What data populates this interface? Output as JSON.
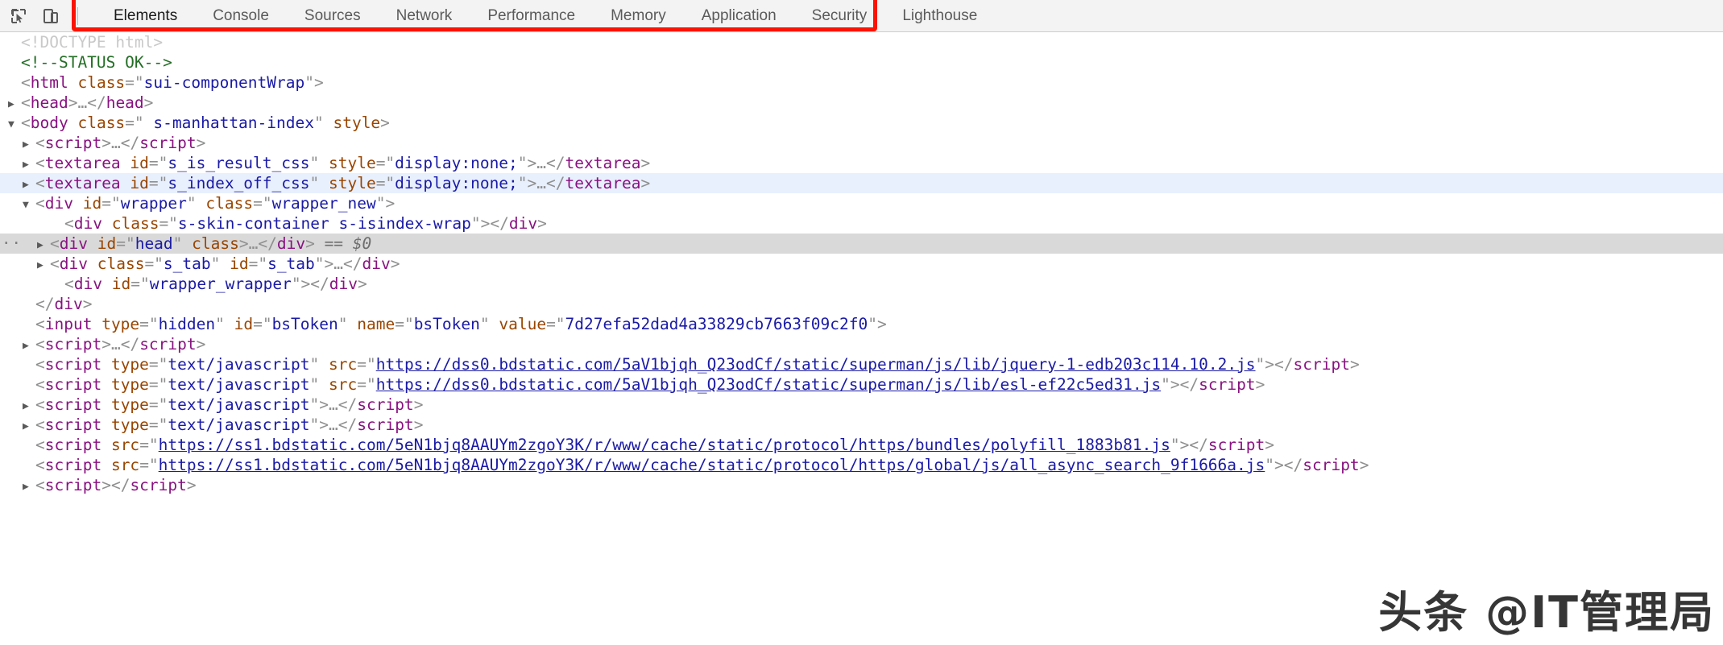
{
  "toolbar": {
    "icons": [
      {
        "name": "inspect-element-icon",
        "label": "Inspect element"
      },
      {
        "name": "device-toolbar-icon",
        "label": "Toggle device toolbar"
      }
    ],
    "tabs": [
      {
        "label": "Elements",
        "active": true
      },
      {
        "label": "Console",
        "active": false
      },
      {
        "label": "Sources",
        "active": false
      },
      {
        "label": "Network",
        "active": false
      },
      {
        "label": "Performance",
        "active": false
      },
      {
        "label": "Memory",
        "active": false
      },
      {
        "label": "Application",
        "active": false
      },
      {
        "label": "Security",
        "active": false
      },
      {
        "label": "Lighthouse",
        "active": false
      }
    ]
  },
  "annotation": {
    "color": "#fb1302",
    "target": "panel-tab-bar"
  },
  "colors": {
    "tag": "#881280",
    "attribute_name": "#994500",
    "attribute_value": "#1a1aa6",
    "comment": "#236e25",
    "punctuation": "#8f8f8f",
    "selected_row": "#d9d9d9",
    "hover_row": "#e8f0fd",
    "annotation_red": "#fb1302",
    "toolbar_bg": "#f3f3f3"
  },
  "dom": {
    "doctype_faded": "<!DOCTYPE html>",
    "comment_status": "<!--STATUS OK-->",
    "rows": {
      "html_open": {
        "tag": "html",
        "attr": "class",
        "value": "sui-componentWrap"
      },
      "head": {
        "tag": "head"
      },
      "body_open": {
        "tag": "body",
        "attr": "class",
        "value": " s-manhattan-index",
        "attr2": "style"
      },
      "script_1": {
        "tag": "script"
      },
      "textarea_1": {
        "tag": "textarea",
        "attr": "id",
        "value": "s_is_result_css",
        "attr2": "style",
        "value2": "display:none;"
      },
      "textarea_2": {
        "tag": "textarea",
        "attr": "id",
        "value": "s_index_off_css",
        "attr2": "style",
        "value2": "display:none;"
      },
      "div_wrapper": {
        "tag": "div",
        "attr": "id",
        "value": "wrapper",
        "attr2": "class",
        "value2": "wrapper_new"
      },
      "div_skin": {
        "tag": "div",
        "attr": "class",
        "value": "s-skin-container s-isindex-wrap"
      },
      "div_head": {
        "tag": "div",
        "attr": "id",
        "value": "head",
        "attr2": "class",
        "marker": "== $0"
      },
      "div_stab": {
        "tag": "div",
        "attr": "class",
        "value": "s_tab",
        "attr2": "id",
        "value2": "s_tab"
      },
      "div_wrapper_wrap": {
        "tag": "div",
        "attr": "id",
        "value": "wrapper_wrapper"
      },
      "div_wrapper_close": {
        "tag": "div"
      },
      "input_bstoken": {
        "tag": "input",
        "attr": "type",
        "value": "hidden",
        "attr2": "id",
        "value2": "bsToken",
        "attr3": "name",
        "value3": "bsToken",
        "attr4": "value",
        "value4": "7d27efa52dad4a33829cb7663f09c2f0"
      },
      "script_2": {
        "tag": "script"
      },
      "script_jquery": {
        "tag": "script",
        "attr": "type",
        "value": "text/javascript",
        "attr2": "src",
        "url": "https://dss0.bdstatic.com/5aV1bjqh_Q23odCf/static/superman/js/lib/jquery-1-edb203c114.10.2.js"
      },
      "script_esl": {
        "tag": "script",
        "attr": "type",
        "value": "text/javascript",
        "attr2": "src",
        "url": "https://dss0.bdstatic.com/5aV1bjqh_Q23odCf/static/superman/js/lib/esl-ef22c5ed31.js"
      },
      "script_3": {
        "tag": "script",
        "attr": "type",
        "value": "text/javascript"
      },
      "script_4": {
        "tag": "script",
        "attr": "type",
        "value": "text/javascript"
      },
      "script_polyfill": {
        "tag": "script",
        "attr": "src",
        "url": "https://ss1.bdstatic.com/5eN1bjq8AAUYm2zgoY3K/r/www/cache/static/protocol/https/bundles/polyfill_1883b81.js"
      },
      "script_allasync": {
        "tag": "script",
        "attr": "src",
        "url": "https://ss1.bdstatic.com/5eN1bjq8AAUYm2zgoY3K/r/www/cache/static/protocol/https/global/js/all_async_search_9f1666a.js"
      },
      "script_5": {
        "tag": "script"
      }
    },
    "symbols": {
      "ellipsis": "…",
      "quote": "\"",
      "lt": "<",
      "gt": ">",
      "slash": "/",
      "eq": "=",
      "dollar_marker": "== $0"
    }
  },
  "watermark": {
    "text": "头条 @IT管理局"
  }
}
